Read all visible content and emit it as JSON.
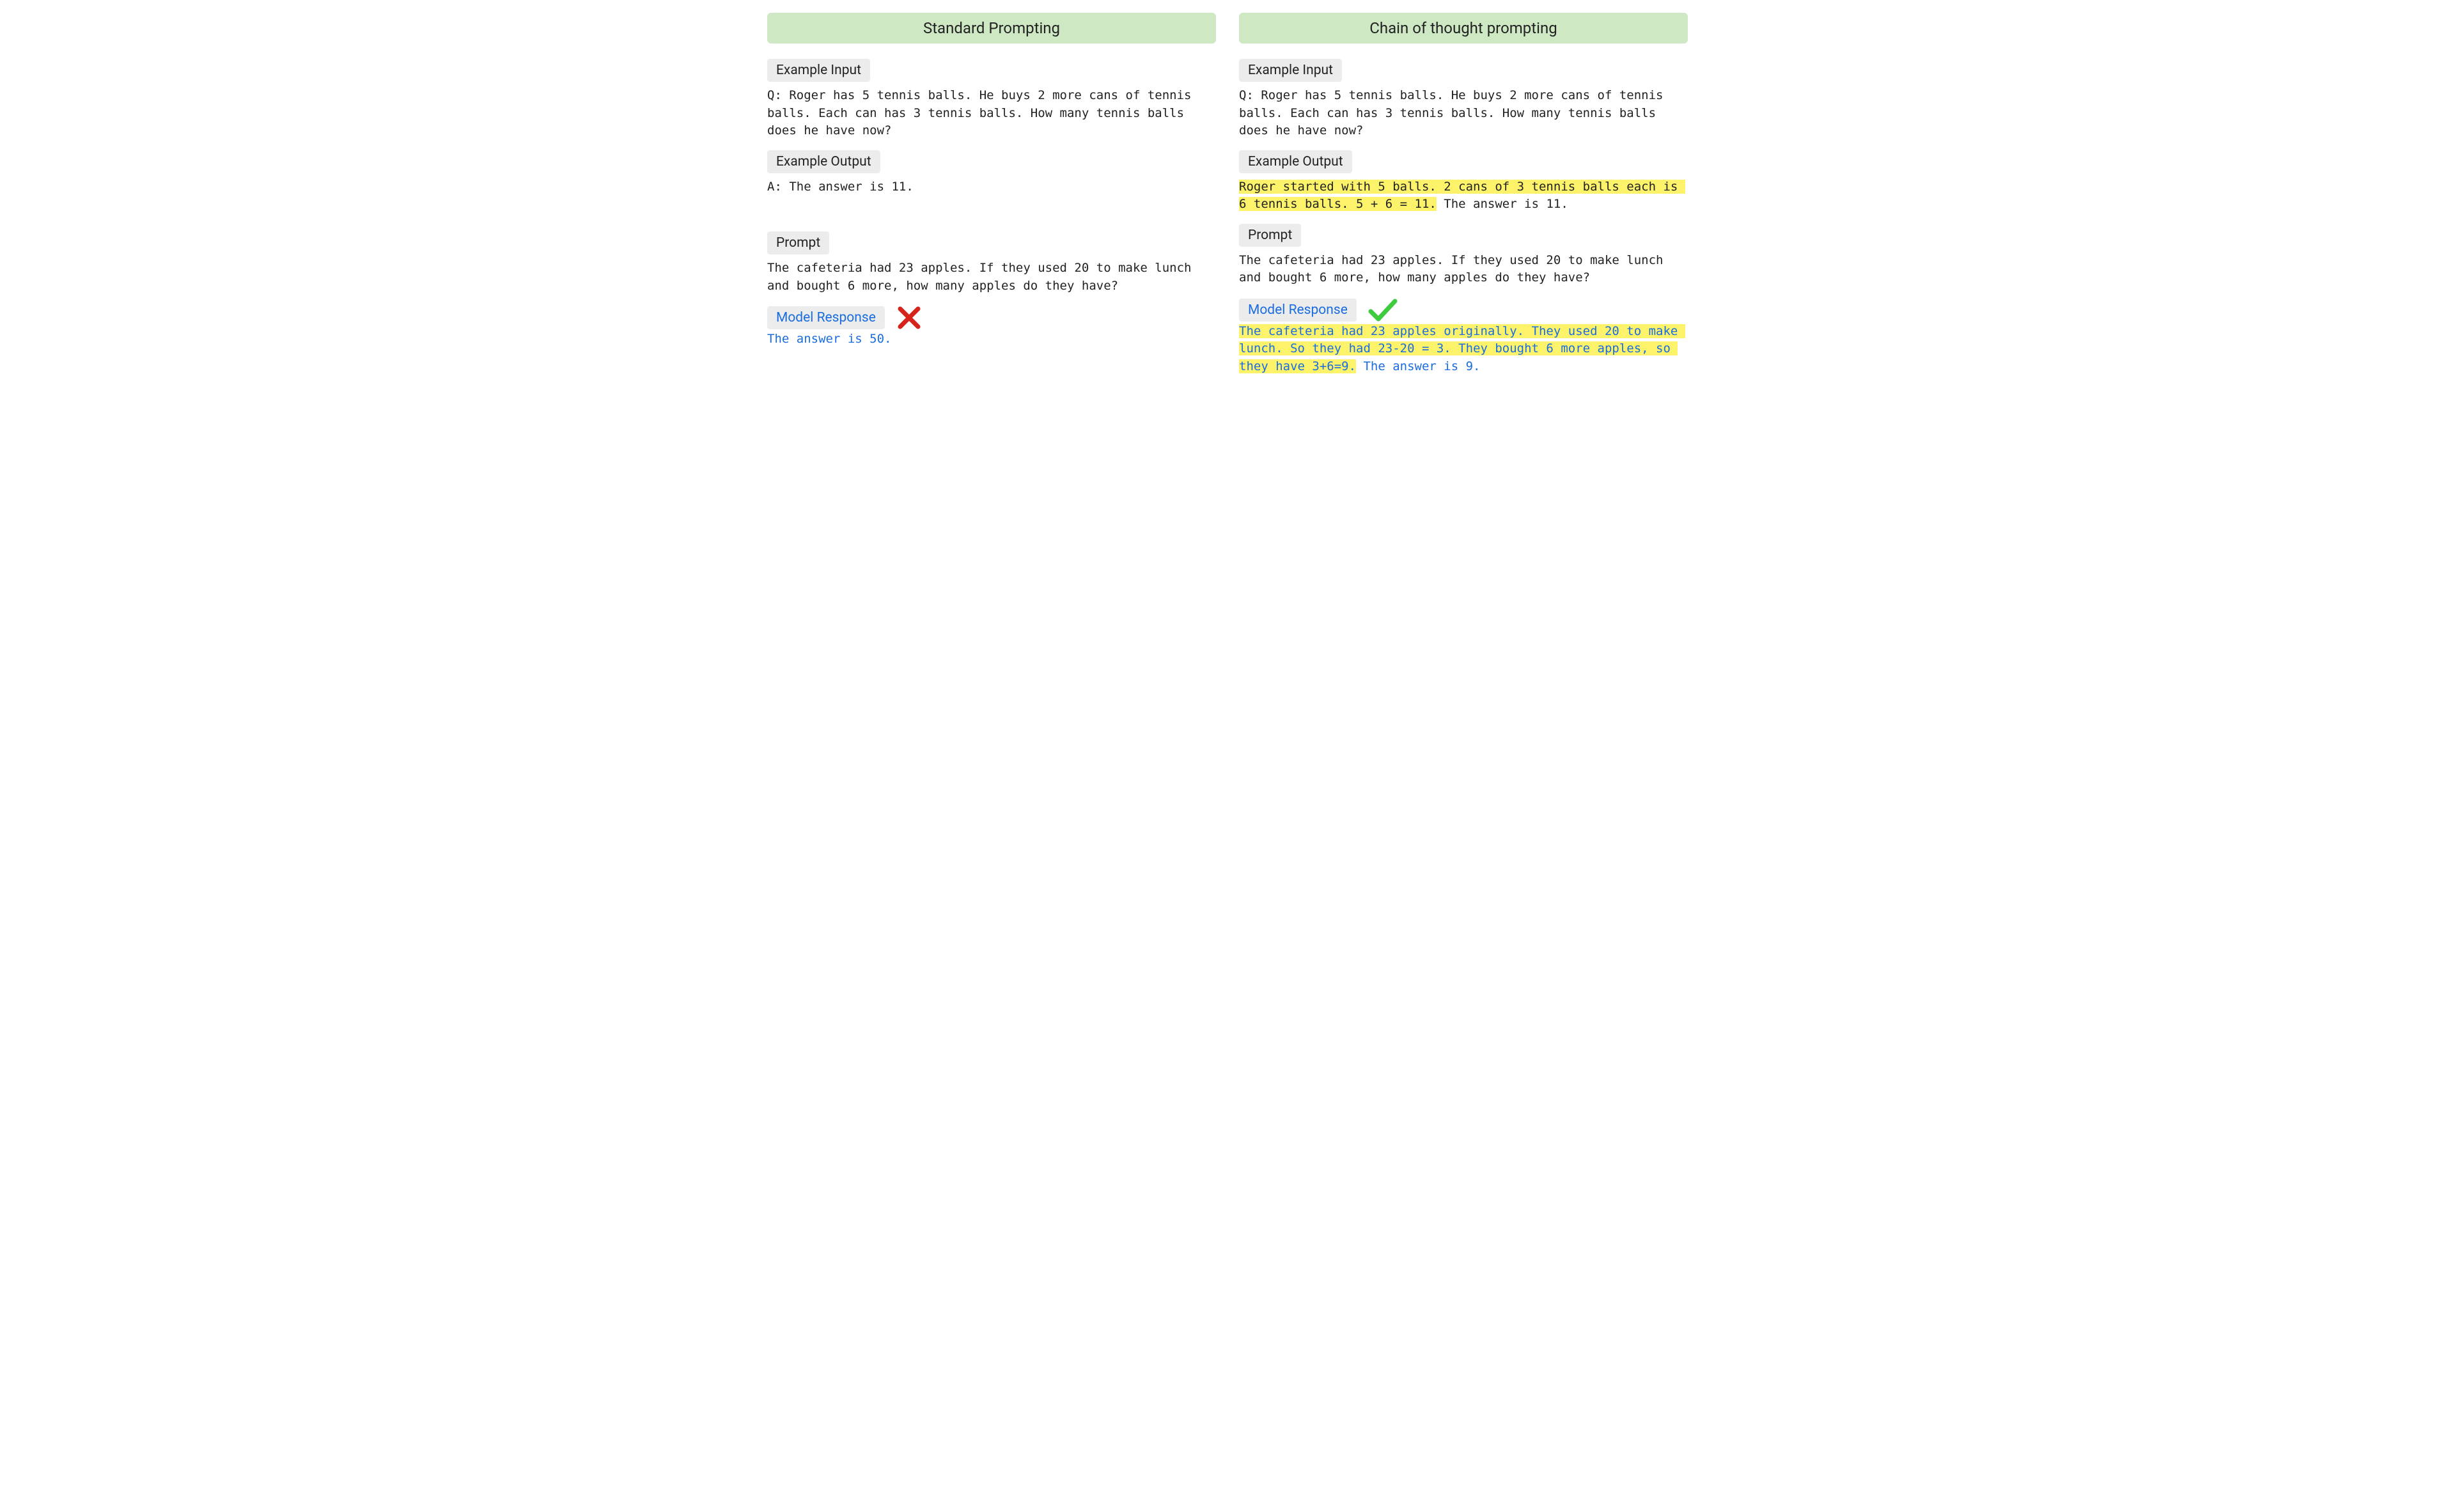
{
  "left": {
    "title": "Standard Prompting",
    "exInputLabel": "Example Input",
    "exInput": "Q: Roger has 5 tennis balls. He buys 2 more cans of tennis balls. Each can has 3 tennis balls. How many tennis balls does he have now?",
    "exOutputLabel": "Example Output",
    "exOutput": "A: The answer is 11.",
    "promptLabel": "Prompt",
    "prompt": "The cafeteria had 23 apples. If they used 20 to make lunch and bought 6 more, how many apples do they have?",
    "respLabel": "Model Response",
    "respMark": "cross",
    "resp": "The answer is 50."
  },
  "right": {
    "title": "Chain of thought prompting",
    "exInputLabel": "Example Input",
    "exInput": "Q: Roger has 5 tennis balls. He buys 2 more cans of tennis balls. Each can has 3 tennis balls. How many tennis balls does he have now?",
    "exOutputLabel": "Example Output",
    "exOutputHl": "Roger started with 5 balls. 2 cans of 3 tennis balls each is 6 tennis balls. 5 + 6 = 11.",
    "exOutputTail": " The answer is 11.",
    "promptLabel": "Prompt",
    "prompt": "The cafeteria had 23 apples. If they used 20 to make lunch and bought 6 more, how many apples do they have?",
    "respLabel": "Model Response",
    "respMark": "check",
    "respHl": "The cafeteria had 23 apples originally. They used 20 to make lunch. So they had 23-20 = 3. They bought 6 more apples, so they have 3+6=9.",
    "respTail": " The answer is 9."
  }
}
